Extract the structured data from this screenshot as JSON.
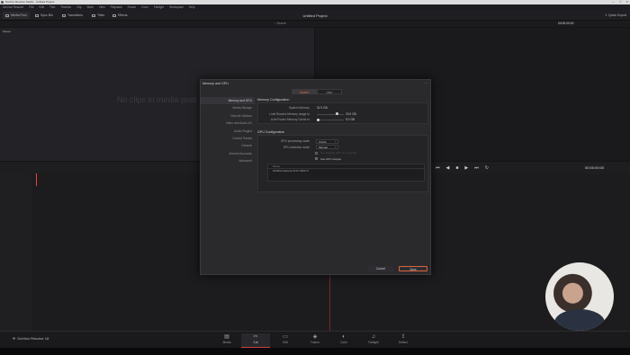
{
  "window": {
    "title": "DaVinci Resolve Studio - Untitled Project",
    "controls": [
      "—",
      "☐",
      "✕"
    ]
  },
  "menu": [
    "DaVinci Resolve",
    "File",
    "Edit",
    "Trim",
    "Timeline",
    "Clip",
    "Mark",
    "View",
    "Playback",
    "Fusion",
    "Color",
    "Fairlight",
    "Workspace",
    "Help"
  ],
  "toolbar": {
    "media_pool": "Media Pool",
    "sync_bin": "Sync Bin",
    "transitions": "Transitions",
    "titles": "Titles",
    "effects": "Effects",
    "project_title": "Untitled Project",
    "quick_export": "Quick Export"
  },
  "subbar": {
    "search": "Search",
    "timecode": "00:00:00:00"
  },
  "pool": {
    "bin": "Master",
    "empty_text": "No clips in media pool"
  },
  "viewer": {
    "timecode": "00:00:00:00"
  },
  "dialog": {
    "title": "Memory and GPU",
    "tabs": [
      "System",
      "User"
    ],
    "active_tab": "System",
    "sidebar": [
      "Memory and GPU",
      "Media Storage",
      "Decode Options",
      "Video and Audio I/O",
      "Audio Plugins",
      "Control Panels",
      "General",
      "Internet Accounts",
      "Advanced"
    ],
    "active_sidebar": "Memory and GPU",
    "memory": {
      "section": "Memory Configuration",
      "system_memory_label": "System Memory",
      "system_memory_value": "31.9 GB",
      "resolve_limit_label": "Limit Resolve Memory usage to",
      "resolve_limit_value": "23.9 GB",
      "resolve_limit_fraction": 0.75,
      "fusion_limit_label": "Limit Fusion Memory Cache to",
      "fusion_limit_value": "5.0 GB",
      "fusion_limit_fraction": 0.05
    },
    "gpu": {
      "section": "GPU Configuration",
      "processing_label": "GPU processing mode",
      "processing_value": "CUDA",
      "selection_label": "GPU selection mode",
      "selection_value": "Manual",
      "display_gpu_label": "Use Display GPU for compute",
      "display_gpu_checked": false,
      "use_gpu_label": "Use GPU scopes",
      "use_gpu_checked": true,
      "list_header": "Name",
      "list_rows": [
        "NVIDIA GeForce RTX 3060 Ti"
      ]
    },
    "cancel": "Cancel",
    "save": "Save"
  },
  "timeline": {
    "timecode": "00:00:00:00"
  },
  "pages": [
    "Media",
    "Cut",
    "Edit",
    "Fusion",
    "Color",
    "Fairlight",
    "Deliver"
  ],
  "active_page": "Cut",
  "brand": "DaVinci Resolve 18",
  "colors": {
    "accent": "#d8623a",
    "playhead": "#e3433b",
    "active_tab": "#e06a3a"
  }
}
